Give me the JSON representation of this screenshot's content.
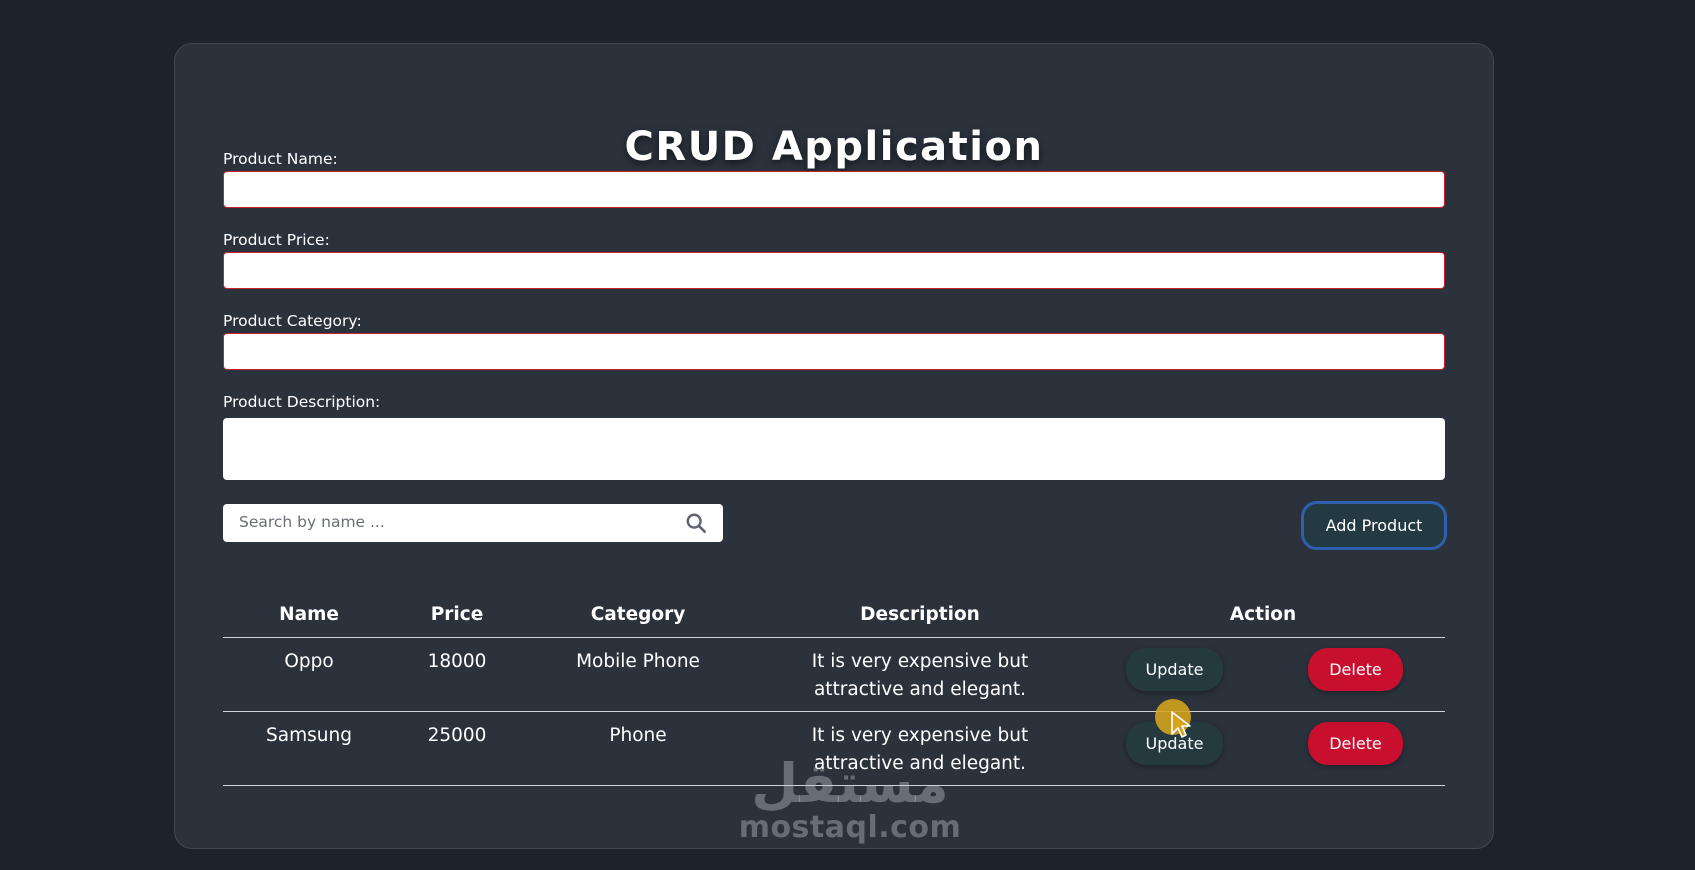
{
  "app": {
    "title": "CRUD Application"
  },
  "form": {
    "name_label": "Product Name:",
    "name_value": "",
    "price_label": "Product Price:",
    "price_value": "",
    "category_label": "Product Category:",
    "category_value": "",
    "description_label": "Product Description:",
    "description_value": ""
  },
  "search": {
    "placeholder": "Search by name ...",
    "icon": "search-icon"
  },
  "add_button": {
    "label": "Add Product"
  },
  "table": {
    "headers": [
      "Name",
      "Price",
      "Category",
      "Description",
      "Action"
    ],
    "rows": [
      {
        "name": "Oppo",
        "price": "18000",
        "category": "Mobile Phone",
        "description": "It is very expensive but attractive and elegant.",
        "update_label": "Update",
        "delete_label": "Delete"
      },
      {
        "name": "Samsung",
        "price": "25000",
        "category": "Phone",
        "description": "It is very expensive but attractive and elegant.",
        "update_label": "Update",
        "delete_label": "Delete"
      }
    ]
  },
  "watermark": {
    "arabic": "مستقل",
    "latin": "mostaql.com"
  },
  "colors": {
    "page_background": "#1c232c",
    "card_background": "#2b323c",
    "input_border": "#c8232c",
    "add_button_border": "#2f5fae",
    "delete_button": "#c8102e",
    "update_button": "#253a3f",
    "cursor_highlight": "#d6a51c"
  }
}
